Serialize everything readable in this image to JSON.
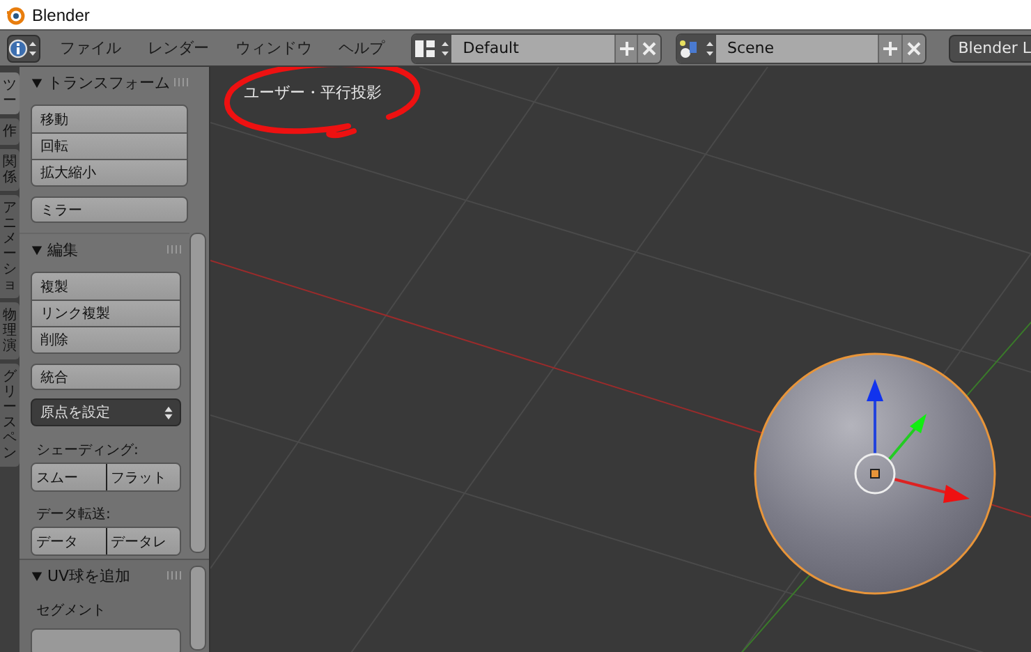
{
  "window": {
    "title": "Blender"
  },
  "header": {
    "menus": [
      "ファイル",
      "レンダー",
      "ウィンドウ",
      "ヘルプ"
    ],
    "layout": {
      "value": "Default"
    },
    "scene": {
      "value": "Scene"
    },
    "engine": {
      "label": "Blender L"
    }
  },
  "tool_tabs": [
    {
      "label": "ツー",
      "selected": true
    },
    {
      "label": "作",
      "selected": false
    },
    {
      "label": "関係",
      "selected": false
    },
    {
      "label": "アニメーショ",
      "selected": false
    },
    {
      "label": "物理演",
      "selected": false
    },
    {
      "label": "グリースペン",
      "selected": false
    }
  ],
  "panels": [
    {
      "title": "トランスフォーム",
      "expanded": true,
      "items": [
        {
          "kind": "button_group",
          "buttons": [
            "移動",
            "回転",
            "拡大縮小"
          ]
        },
        {
          "kind": "button",
          "label": "ミラー"
        }
      ]
    },
    {
      "title": "編集",
      "expanded": true,
      "items": [
        {
          "kind": "button_group",
          "buttons": [
            "複製",
            "リンク複製",
            "削除"
          ]
        },
        {
          "kind": "button",
          "label": "統合"
        },
        {
          "kind": "dropdown",
          "value": "原点を設定"
        },
        {
          "kind": "label",
          "text": "シェーディング:"
        },
        {
          "kind": "split_buttons",
          "buttons": [
            "スムー",
            "フラット"
          ]
        },
        {
          "kind": "label",
          "text": "データ転送:"
        },
        {
          "kind": "split_buttons",
          "buttons": [
            "データ",
            "データレ"
          ]
        }
      ]
    },
    {
      "title": "UV球を追加",
      "expanded": true,
      "items": [
        {
          "kind": "label",
          "text": "セグメント"
        },
        {
          "kind": "field"
        }
      ]
    }
  ],
  "viewport": {
    "view_label": "ユーザー・平行投影"
  }
}
